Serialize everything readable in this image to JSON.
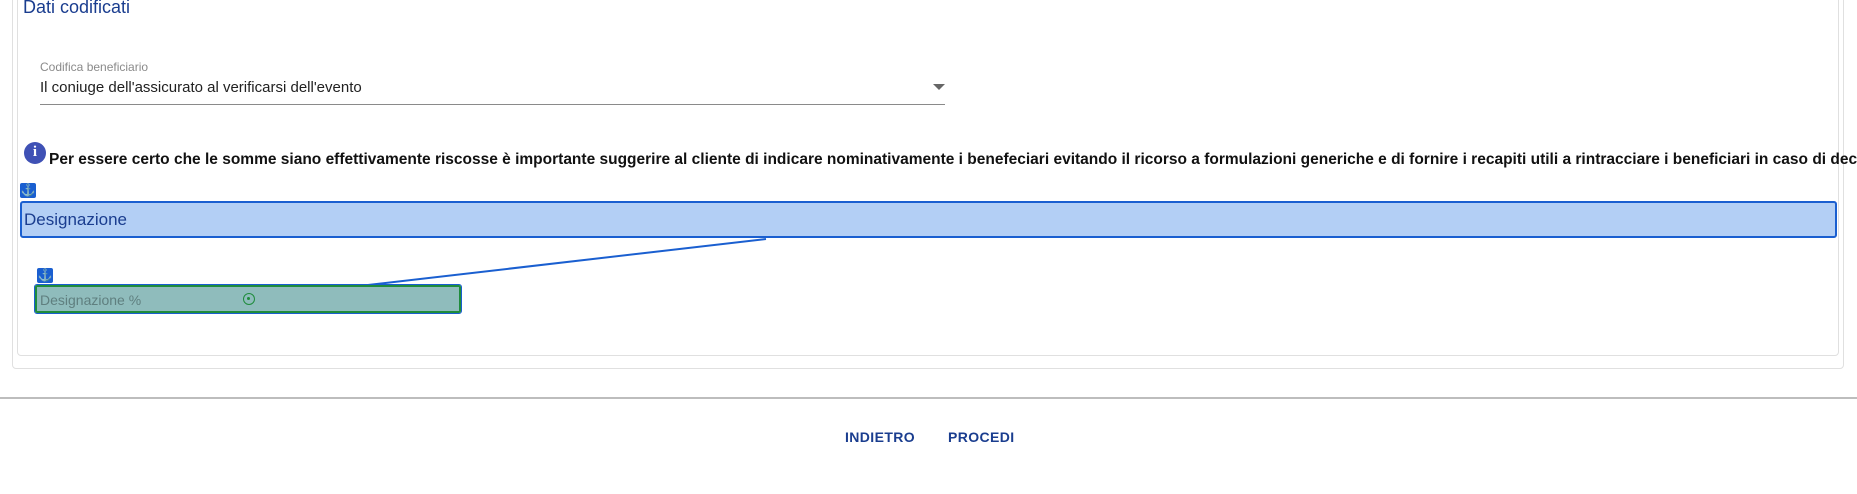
{
  "section": {
    "title": "Dati codificati"
  },
  "codifica": {
    "label": "Codifica beneficiario",
    "value": "Il coniuge dell'assicurato al verificarsi dell'evento"
  },
  "info": {
    "icon": "i",
    "text": "Per essere certo che le somme siano effettivamente riscosse è importante suggerire al cliente di indicare nominativamente i benefeciari evitando il ricorso a formulazioni generiche e di fornire i recapiti utili a rintracciare i beneficiari in caso di decesso."
  },
  "designazione": {
    "title": "Designazione",
    "percent_placeholder": "Designazione %"
  },
  "anchors": {
    "symbol": "⚓"
  },
  "footer": {
    "back_label": "INDIETRO",
    "next_label": "PROCEDI"
  },
  "colors": {
    "accent": "#1a3d8f",
    "selection": "#1a5fd0",
    "highlight": "#b3cff5",
    "target": "#1f8c3c"
  }
}
